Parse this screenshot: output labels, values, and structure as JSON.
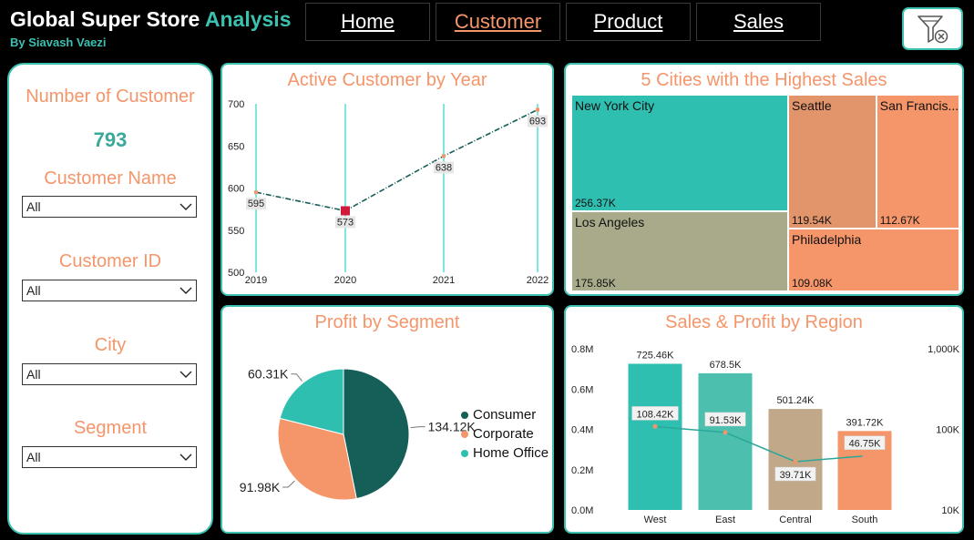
{
  "header": {
    "title_a": "Global Super Store",
    "title_b": "Analysis",
    "subtitle": "By Siavash Vaezi",
    "nav": [
      {
        "label": "Home",
        "active": false
      },
      {
        "label": "Customer",
        "active": true
      },
      {
        "label": "Product",
        "active": false
      },
      {
        "label": "Sales",
        "active": false
      }
    ],
    "filter_icon": "clear-filter-icon"
  },
  "sidebar": {
    "count_label": "Number of Customer",
    "count_value": "793",
    "filters": [
      {
        "label": "Customer Name",
        "value": "All"
      },
      {
        "label": "Customer ID",
        "value": "All"
      },
      {
        "label": "City",
        "value": "All"
      },
      {
        "label": "Segment",
        "value": "All"
      }
    ]
  },
  "colors": {
    "teal": "#2fbfb0",
    "orange": "#f4956a",
    "dark_teal": "#165e58",
    "khaki": "#a8aa8a",
    "tan": "#c0a888",
    "marker": "#d01a3c",
    "gridline": "#7de8e0"
  },
  "chart_data": [
    {
      "type": "line",
      "title": "Active Customer by Year",
      "x": [
        "2019",
        "2020",
        "2021",
        "2022"
      ],
      "values": [
        595,
        573,
        638,
        693
      ],
      "y_ticks": [
        500,
        550,
        600,
        650,
        700
      ],
      "ylim": [
        500,
        700
      ],
      "grid": "vertical"
    },
    {
      "type": "treemap",
      "title": "5 Cities with the Highest Sales",
      "items": [
        {
          "name": "New York City",
          "label": "256.37K",
          "value": 256.37
        },
        {
          "name": "Los Angeles",
          "label": "175.85K",
          "value": 175.85
        },
        {
          "name": "Seattle",
          "label": "119.54K",
          "value": 119.54
        },
        {
          "name": "San Francis...",
          "label": "112.67K",
          "value": 112.67
        },
        {
          "name": "Philadelphia",
          "label": "109.08K",
          "value": 109.08
        }
      ]
    },
    {
      "type": "pie",
      "title": "Profit by Segment",
      "slices": [
        {
          "name": "Consumer",
          "value": 134.12,
          "label": "134.12K"
        },
        {
          "name": "Corporate",
          "value": 91.98,
          "label": "91.98K"
        },
        {
          "name": "Home Office",
          "value": 60.31,
          "label": "60.31K"
        }
      ],
      "legend": "right"
    },
    {
      "type": "bar",
      "title": "Sales & Profit by Region",
      "categories": [
        "West",
        "East",
        "Central",
        "South"
      ],
      "bars": {
        "values": [
          725.46,
          678.5,
          501.24,
          391.72
        ],
        "labels": [
          "725.46K",
          "678.5K",
          "501.24K",
          "391.72K"
        ]
      },
      "line": {
        "values": [
          108.42,
          91.53,
          39.71,
          46.75
        ],
        "labels": [
          "108.42K",
          "91.53K",
          "39.71K",
          "46.75K"
        ]
      },
      "y_left_ticks": [
        "0.0M",
        "0.2M",
        "0.4M",
        "0.6M",
        "0.8M"
      ],
      "y_left_range": [
        0,
        800
      ],
      "y_right_ticks": [
        "10K",
        "100K",
        "1,000K"
      ],
      "y_right_scale": "log",
      "y_right_range": [
        10,
        1000
      ]
    }
  ]
}
